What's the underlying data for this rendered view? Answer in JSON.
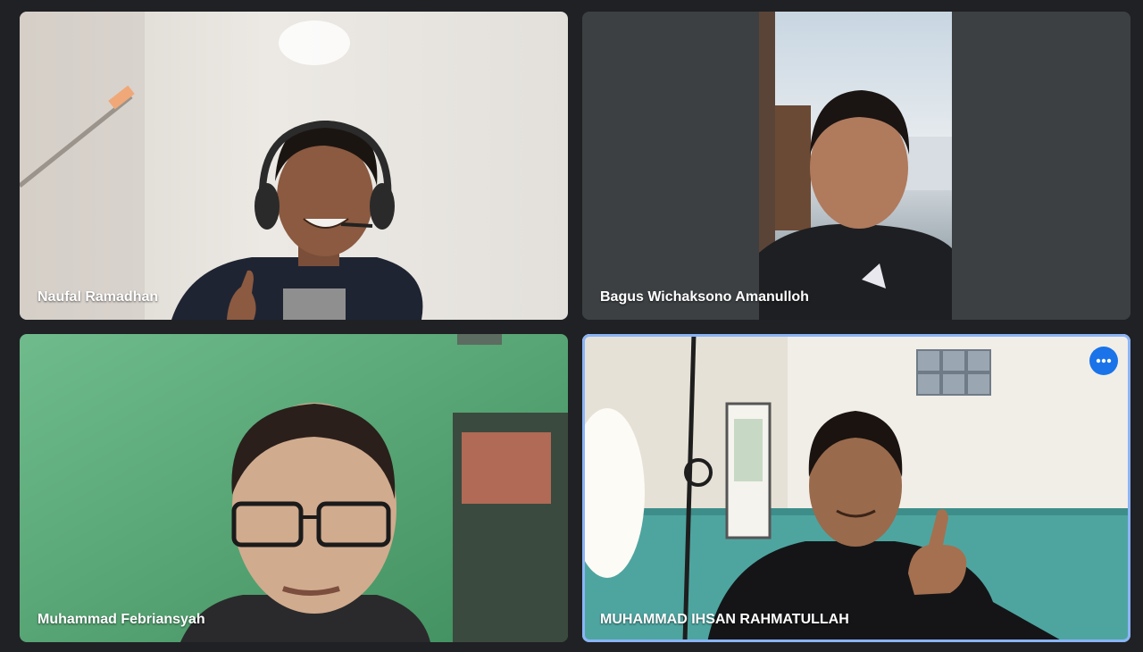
{
  "meeting": {
    "participants": [
      {
        "name": "Naufal Ramadhan"
      },
      {
        "name": "Bagus Wichaksono Amanulloh"
      },
      {
        "name": "Muhammad Febriansyah"
      },
      {
        "name": "MUHAMMAD IHSAN RAHMATULLAH",
        "active_speaker": true,
        "menu_icon": "more-options-icon"
      }
    ]
  },
  "colors": {
    "background": "#202124",
    "active_border": "#8ab4f8",
    "menu_button": "#1a73e8"
  }
}
